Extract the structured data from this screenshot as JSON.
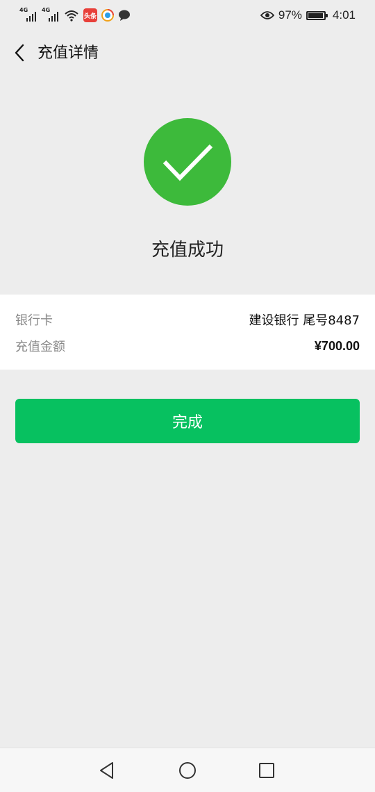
{
  "status_bar": {
    "network_label_1": "4G",
    "network_label_2": "4G",
    "news_badge_text": "头条",
    "battery_percent": "97%",
    "battery_level": 0.97,
    "time": "4:01"
  },
  "header": {
    "title": "充值详情",
    "back_icon": "chevron-left-icon"
  },
  "result": {
    "icon": "check-circle-icon",
    "title": "充值成功"
  },
  "details": {
    "rows": [
      {
        "label": "银行卡",
        "value": "建设银行 尾号8487"
      },
      {
        "label": "充值金额",
        "value": "¥700.00"
      }
    ]
  },
  "actions": {
    "done_label": "完成"
  },
  "colors": {
    "accent_green": "#07c160",
    "success_green": "#3dba3b",
    "background": "#ededed"
  }
}
